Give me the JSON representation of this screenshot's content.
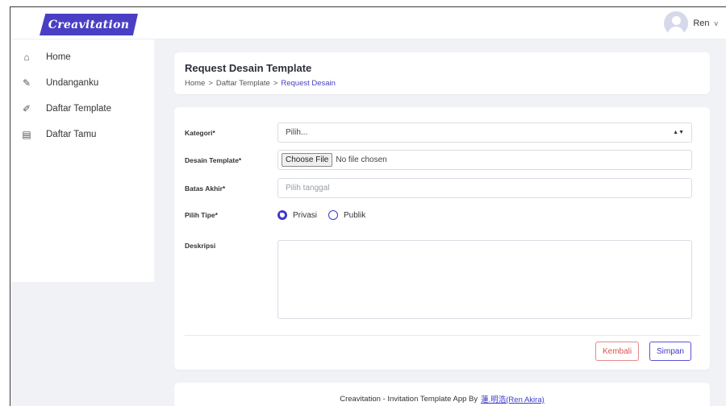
{
  "app": {
    "logo_text": "Creavitation"
  },
  "header": {
    "user_name": "Ren",
    "dropdown_glyph": "v"
  },
  "sidebar": {
    "items": [
      {
        "label": "Home",
        "icon": "home-icon",
        "glyph": "⌂"
      },
      {
        "label": "Undanganku",
        "icon": "invitation-icon",
        "glyph": "✎"
      },
      {
        "label": "Daftar Template",
        "icon": "brush-icon",
        "glyph": "✐"
      },
      {
        "label": "Daftar Tamu",
        "icon": "guestbook-icon",
        "glyph": "▤"
      }
    ]
  },
  "page": {
    "title": "Request Desain Template",
    "breadcrumb": [
      "Home",
      "Daftar Template",
      "Request Desain"
    ],
    "breadcrumb_sep": ">"
  },
  "form": {
    "kategori_label": "Kategori*",
    "kategori_value": "Pilih...",
    "desain_label": "Desain Template*",
    "file_button": "Choose File",
    "file_status": "No file chosen",
    "batas_label": "Batas Akhir*",
    "batas_placeholder": "Pilih tanggal",
    "tipe_label": "Pilih Tipe*",
    "tipe_options": [
      "Privasi",
      "Publik"
    ],
    "tipe_selected": "Privasi",
    "deskripsi_label": "Deskripsi",
    "back_button": "Kembali",
    "save_button": "Simpan"
  },
  "footer": {
    "text": "Creavitation - Invitation Template App By",
    "author_link": "蓮.明浩(Ren Akira)"
  },
  "colors": {
    "accent": "#3d39c9",
    "logo_bg": "#4a3fc4",
    "danger": "#d9534f",
    "page_bg": "#f1f2f6"
  }
}
